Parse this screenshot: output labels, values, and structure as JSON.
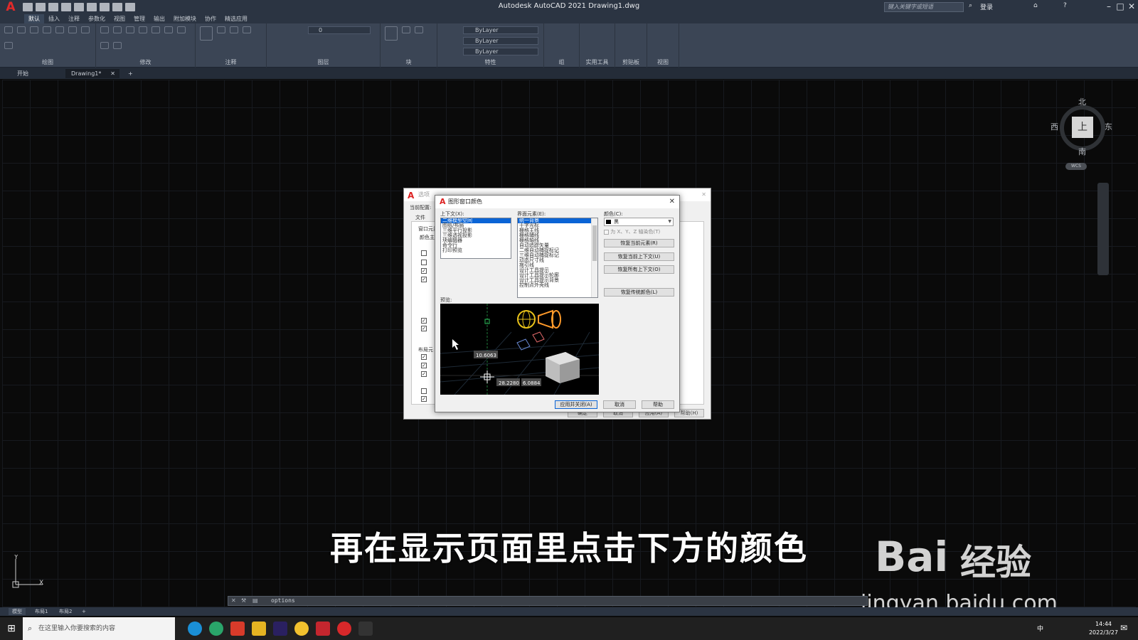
{
  "titlebar": {
    "app_letter": "A",
    "title": "Autodesk AutoCAD 2021    Drawing1.dwg",
    "search_placeholder": "键入关键字或短语",
    "login": "登录"
  },
  "ribbon_tabs": [
    "默认",
    "插入",
    "注释",
    "参数化",
    "视图",
    "管理",
    "输出",
    "附加模块",
    "协作",
    "精选应用"
  ],
  "ribbon_panels": [
    "绘图",
    "修改",
    "注释",
    "图层",
    "块",
    "特性",
    "组",
    "实用工具",
    "剪贴板",
    "视图"
  ],
  "bylayer_label": "ByLayer",
  "layer_value": "0",
  "file_tabs": {
    "start": "开始",
    "drawing": "Drawing1*"
  },
  "viewcube": {
    "north": "北",
    "south": "南",
    "east": "东",
    "west": "西",
    "top": "上",
    "wcs": "WCS"
  },
  "ucs": {
    "x": "X",
    "y": "Y"
  },
  "options_dialog": {
    "title": "选项",
    "current_config": "当前配置:",
    "tab_file": "文件",
    "section_window": "窗口元素",
    "color_scheme": "颜色主",
    "section_layout": "布局元",
    "ok": "确定",
    "cancel": "取消",
    "apply": "应用(A)",
    "help": "帮助(H)"
  },
  "color_dialog": {
    "title": "图形窗口颜色",
    "context_label": "上下文(X):",
    "contexts": [
      "二维模型空间",
      "图纸/布局",
      "三维平行投影",
      "三维透视投影",
      "块编辑器",
      "命令行",
      "打印预览"
    ],
    "element_label": "界面元素(E):",
    "elements": [
      "统一背景",
      "十字光标",
      "栅格主线",
      "栅格辅线",
      "栅格轴线",
      "自动追踪矢量",
      "二维自动捕捉标记",
      "三维自动捕捉标记",
      "动态尺寸线",
      "拖引线",
      "设计工具提示",
      "设计工具提示轮廓",
      "设计工具提示背景",
      "控制点外壳线"
    ],
    "color_label": "颜色(C):",
    "color_value": "黑",
    "tint_label": "为 X、Y、Z 轴染色(T)",
    "restore_element": "恢复当前元素(R)",
    "restore_context": "恢复当前上下文(U)",
    "restore_all": "恢复所有上下文(O)",
    "restore_classic": "恢复传统颜色(L)",
    "preview_label": "预览:",
    "preview_values": [
      "10.6063",
      "28.2280",
      "6.0884"
    ],
    "apply_close": "应用并关闭(A)",
    "cancel": "取消",
    "help": "帮助"
  },
  "subtitle": "再在显示页面里点击下方的颜色",
  "watermark": {
    "logo": "Bai",
    "logo_suffix": "经验",
    "url": "jingyan.baidu.com"
  },
  "command": {
    "text": "options"
  },
  "layout_tabs": [
    "模型",
    "布局1",
    "布局2"
  ],
  "taskbar": {
    "search": "在这里输入你要搜索的内容",
    "time": "14:44",
    "date": "2022/3/27",
    "ime": "中"
  }
}
